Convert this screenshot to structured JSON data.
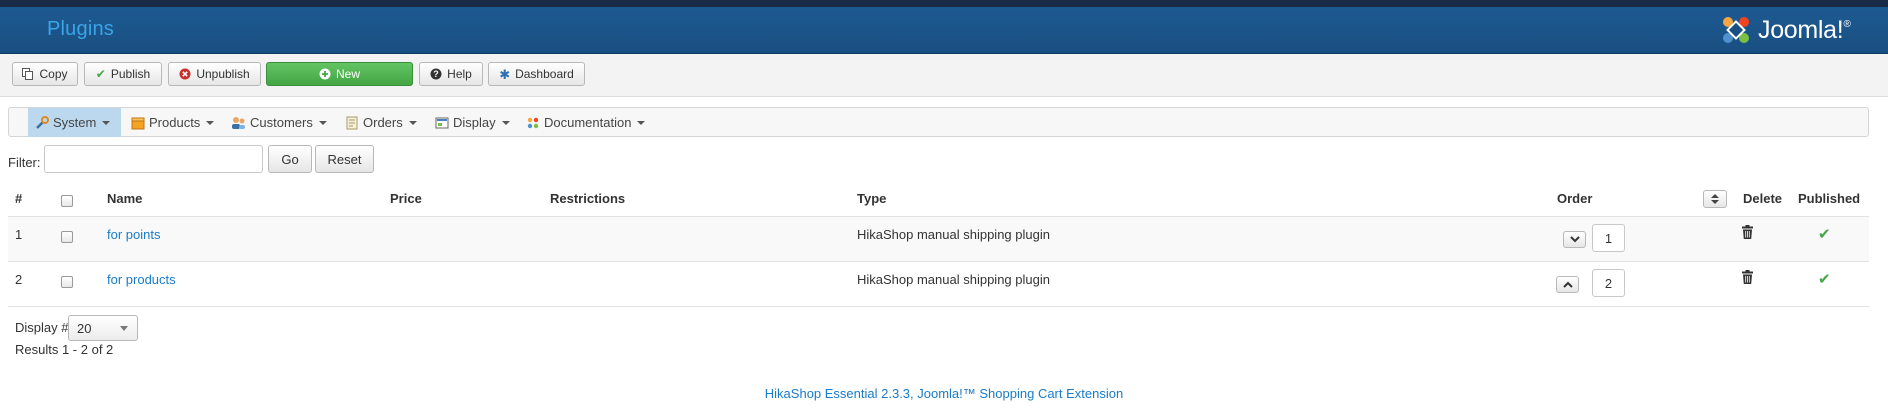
{
  "header": {
    "title": "Plugins",
    "logo_text": "Joomla!",
    "logo_reg": "®"
  },
  "toolbar": [
    {
      "label": "Copy",
      "icon": "copy-icon"
    },
    {
      "label": "Publish",
      "icon": "check-icon"
    },
    {
      "label": "Unpublish",
      "icon": "cancel-icon"
    },
    {
      "label": "New",
      "icon": "plus-circle-icon"
    },
    {
      "label": "Help",
      "icon": "help-icon"
    },
    {
      "label": "Dashboard",
      "icon": "dashboard-icon"
    }
  ],
  "menu": [
    {
      "label": "System",
      "icon": "wrench-icon"
    },
    {
      "label": "Products",
      "icon": "box-icon"
    },
    {
      "label": "Customers",
      "icon": "users-icon"
    },
    {
      "label": "Orders",
      "icon": "orders-icon"
    },
    {
      "label": "Display",
      "icon": "display-icon"
    },
    {
      "label": "Documentation",
      "icon": "documentation-icon"
    }
  ],
  "filter": {
    "label": "Filter:",
    "value": "",
    "go_label": "Go",
    "reset_label": "Reset"
  },
  "table": {
    "headers": {
      "num": "#",
      "name": "Name",
      "price": "Price",
      "restrictions": "Restrictions",
      "type": "Type",
      "order": "Order",
      "delete": "Delete",
      "published": "Published"
    },
    "rows": [
      {
        "num": "1",
        "name": "for points",
        "price": "",
        "restrictions": "",
        "type": "HikaShop manual shipping plugin",
        "order": "1",
        "order_arrow": "down",
        "published": true
      },
      {
        "num": "2",
        "name": "for products",
        "price": "",
        "restrictions": "",
        "type": "HikaShop manual shipping plugin",
        "order": "2",
        "order_arrow": "up",
        "published": true
      }
    ]
  },
  "pagination": {
    "display_label": "Display #",
    "display_value": "20",
    "results": "Results 1 - 2 of 2"
  },
  "footer": {
    "credit": "HikaShop Essential 2.3.3, Joomla!™ Shopping Cart Extension"
  },
  "colors": {
    "header": "#1a4f82",
    "link": "#1a7bc7",
    "new_button": "#51b351",
    "published_check": "#46a546",
    "menu_active": "#bcd8ef"
  }
}
